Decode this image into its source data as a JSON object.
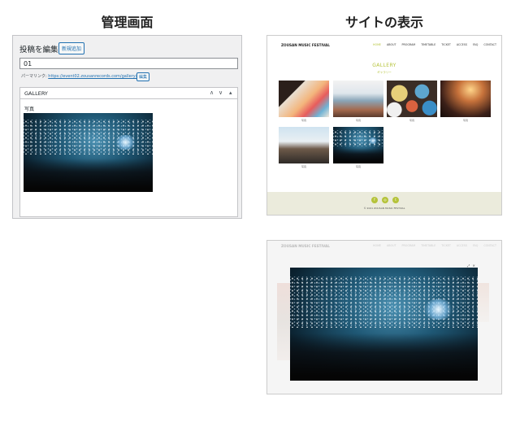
{
  "headings": {
    "admin": "管理画面",
    "site": "サイトの表示"
  },
  "admin": {
    "page_title": "投稿を編集",
    "add_new": "新規追加",
    "title_value": "01",
    "permalink_label": "パーマリンク:",
    "permalink_url": "https://event02.zousanrecords.com/gallery/01/",
    "edit_button": "編集",
    "box_title": "GALLERY",
    "box_controls": {
      "up": "∧",
      "down": "∨",
      "toggle": "▴"
    },
    "photo_label": "写真"
  },
  "site": {
    "logo": "ZOUSAN MUSIC FESTIVAL",
    "nav": [
      "HOME",
      "ABOUT",
      "PROGRAM",
      "TIMETABLE",
      "TICKET",
      "ACCESS",
      "FAQ",
      "CONTACT"
    ],
    "gallery_title": "GALLERY",
    "gallery_sub": "ギャラリー",
    "captions": [
      "写真",
      "写真",
      "写真",
      "写真",
      "写真",
      "写真"
    ],
    "footer_copy": "© 2021 ZOUSAN MUSIC FESTIVAL",
    "social_icons": [
      "facebook-icon",
      "instagram-icon",
      "twitter-icon"
    ],
    "accent_color": "#b5c33a"
  },
  "lightbox": {
    "controls": "⤢ ✕"
  }
}
